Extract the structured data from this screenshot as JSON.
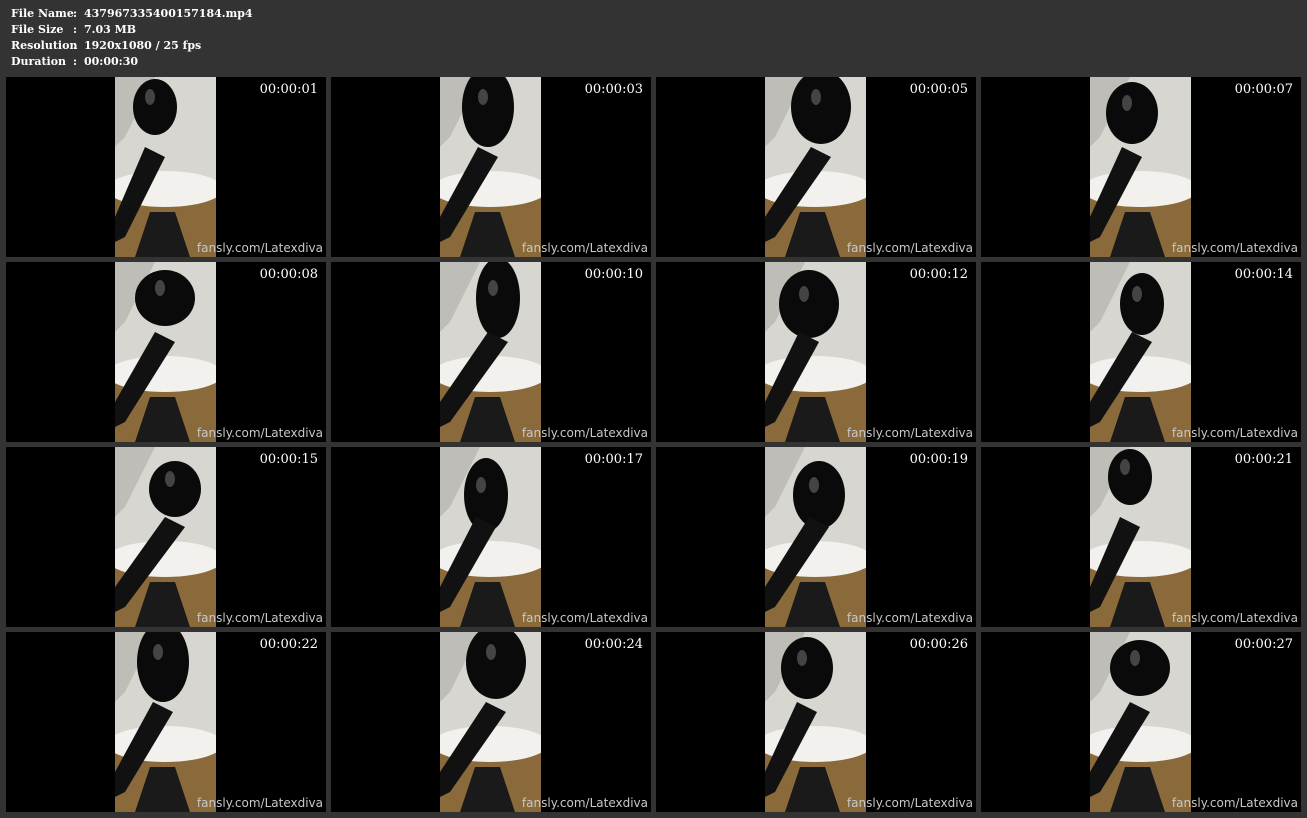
{
  "info": {
    "rows": [
      {
        "label": "File Name",
        "sep": ":",
        "value": "437967335400157184.mp4"
      },
      {
        "label": "File Size",
        "sep": ":",
        "value": "7.03 MB"
      },
      {
        "label": "Resolution",
        "sep": ":",
        "value": "1920x1080 / 25 fps"
      },
      {
        "label": "Duration",
        "sep": ":",
        "value": "00:00:30"
      }
    ]
  },
  "thumbnails": [
    {
      "timestamp": "00:00:01",
      "watermark": "fansly.com/Latexdiva"
    },
    {
      "timestamp": "00:00:03",
      "watermark": "fansly.com/Latexdiva"
    },
    {
      "timestamp": "00:00:05",
      "watermark": "fansly.com/Latexdiva"
    },
    {
      "timestamp": "00:00:07",
      "watermark": "fansly.com/Latexdiva"
    },
    {
      "timestamp": "00:00:08",
      "watermark": "fansly.com/Latexdiva"
    },
    {
      "timestamp": "00:00:10",
      "watermark": "fansly.com/Latexdiva"
    },
    {
      "timestamp": "00:00:12",
      "watermark": "fansly.com/Latexdiva"
    },
    {
      "timestamp": "00:00:14",
      "watermark": "fansly.com/Latexdiva"
    },
    {
      "timestamp": "00:00:15",
      "watermark": "fansly.com/Latexdiva"
    },
    {
      "timestamp": "00:00:17",
      "watermark": "fansly.com/Latexdiva"
    },
    {
      "timestamp": "00:00:19",
      "watermark": "fansly.com/Latexdiva"
    },
    {
      "timestamp": "00:00:21",
      "watermark": "fansly.com/Latexdiva"
    },
    {
      "timestamp": "00:00:22",
      "watermark": "fansly.com/Latexdiva"
    },
    {
      "timestamp": "00:00:24",
      "watermark": "fansly.com/Latexdiva"
    },
    {
      "timestamp": "00:00:26",
      "watermark": "fansly.com/Latexdiva"
    },
    {
      "timestamp": "00:00:27",
      "watermark": "fansly.com/Latexdiva"
    }
  ],
  "colors": {
    "background": "#333333",
    "thumb_background": "#000000",
    "text": "#ffffff",
    "watermark": "#c8c8c8"
  }
}
